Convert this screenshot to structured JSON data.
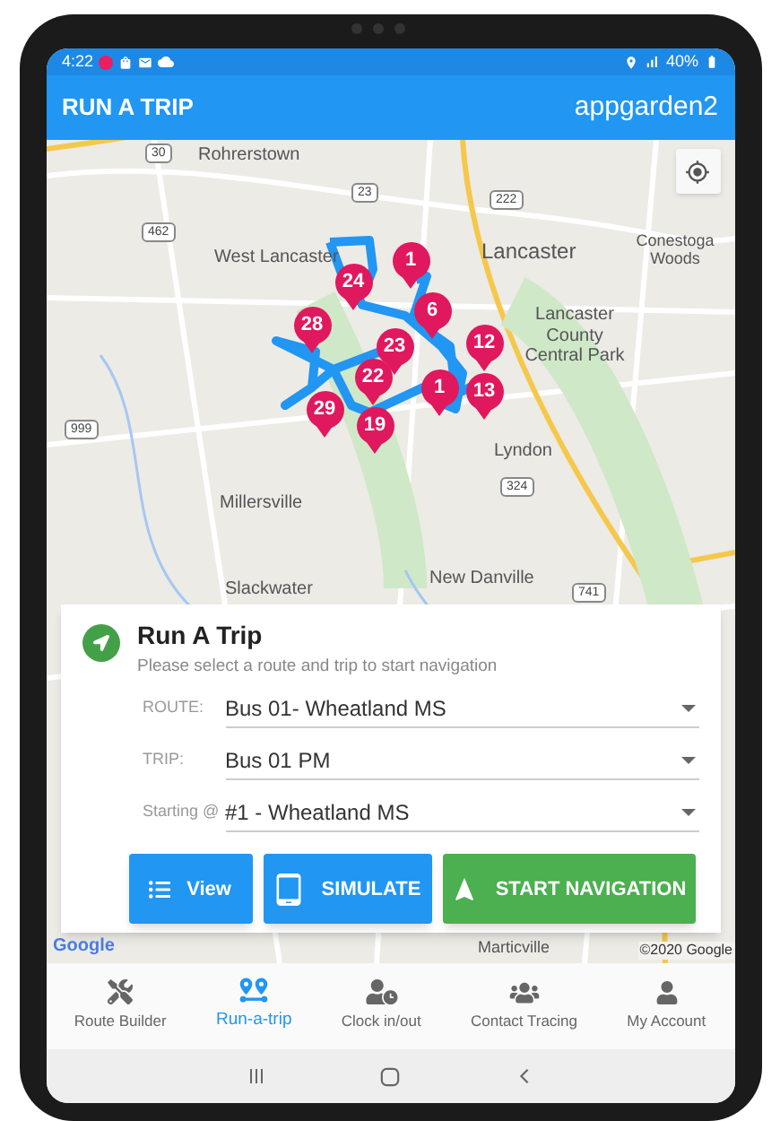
{
  "status_bar": {
    "time": "4:22",
    "battery": "40%"
  },
  "app_bar": {
    "title": "RUN A TRIP",
    "account": "appgarden2"
  },
  "map": {
    "places": [
      "Rohrerstown",
      "West Lancaster",
      "Lancaster",
      "Conestoga Woods",
      "Lancaster County Central Park",
      "Lyndon",
      "Millersville",
      "New Danville",
      "Slackwater",
      "Marticville"
    ],
    "road_shields": [
      "30",
      "462",
      "23",
      "222",
      "999",
      "324",
      "741"
    ],
    "stop_markers": [
      "1",
      "24",
      "6",
      "28",
      "23",
      "22",
      "29",
      "19",
      "12",
      "1",
      "13"
    ],
    "logo": "Google",
    "attribution": "©2020 Google"
  },
  "card": {
    "title": "Run A Trip",
    "subtitle": "Please select a route and trip to start navigation",
    "fields": [
      {
        "label": "ROUTE:",
        "value": "Bus 01- Wheatland MS"
      },
      {
        "label": "TRIP:",
        "value": "Bus 01 PM"
      },
      {
        "label": "Starting @",
        "value": "#1 - Wheatland MS"
      }
    ],
    "buttons": [
      {
        "label": "View",
        "kind": "view"
      },
      {
        "label": "SIMULATE",
        "kind": "simulate"
      },
      {
        "label": "START NAVIGATION",
        "kind": "navigate"
      }
    ]
  },
  "bottom_nav": [
    {
      "label": "Route Builder",
      "selected": false
    },
    {
      "label": "Run-a-trip",
      "selected": true
    },
    {
      "label": "Clock in/out",
      "selected": false
    },
    {
      "label": "Contact Tracing",
      "selected": false
    },
    {
      "label": "My Account",
      "selected": false
    }
  ]
}
